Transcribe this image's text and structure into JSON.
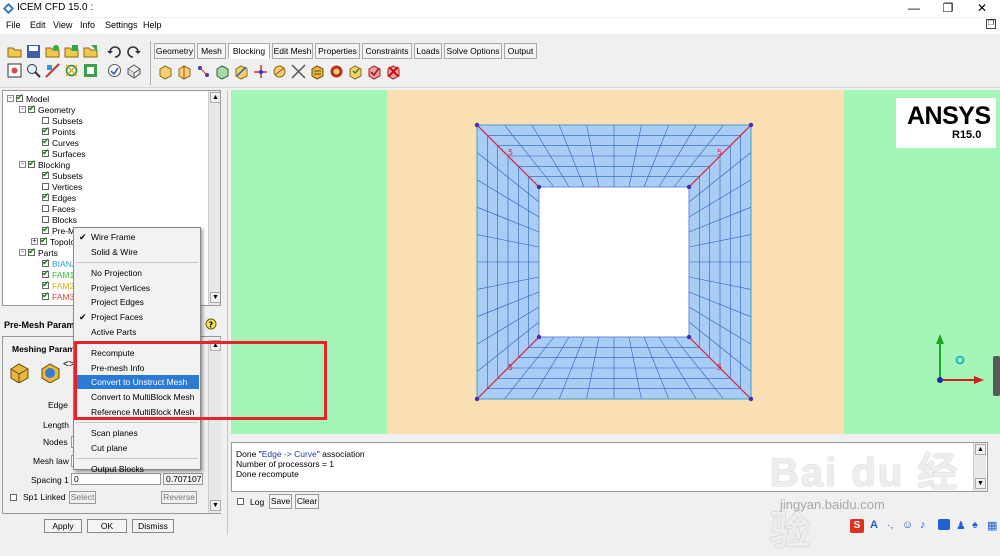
{
  "window": {
    "title": "ICEM CFD 15.0 :",
    "controls": [
      "—",
      "❐",
      "✕"
    ]
  },
  "menubar": [
    "File",
    "Edit",
    "View",
    "Info",
    "Settings",
    "Help"
  ],
  "tabs": [
    {
      "label": "Geometry",
      "active": false
    },
    {
      "label": "Mesh",
      "active": false
    },
    {
      "label": "Blocking",
      "active": true
    },
    {
      "label": "Edit Mesh",
      "active": false
    },
    {
      "label": "Properties",
      "active": false
    },
    {
      "label": "Constraints",
      "active": false
    },
    {
      "label": "Loads",
      "active": false
    },
    {
      "label": "Solve Options",
      "active": false
    },
    {
      "label": "Output",
      "active": false
    }
  ],
  "tree": [
    {
      "label": "Model",
      "level": 0,
      "checked": true,
      "expander": "-",
      "color": "#000000"
    },
    {
      "label": "Geometry",
      "level": 1,
      "checked": true,
      "expander": "-",
      "color": "#000000"
    },
    {
      "label": "Subsets",
      "level": 2,
      "checked": false,
      "color": "#000000"
    },
    {
      "label": "Points",
      "level": 2,
      "checked": true,
      "color": "#000000"
    },
    {
      "label": "Curves",
      "level": 2,
      "checked": true,
      "color": "#000000"
    },
    {
      "label": "Surfaces",
      "level": 2,
      "checked": true,
      "color": "#000000"
    },
    {
      "label": "Blocking",
      "level": 1,
      "checked": true,
      "expander": "-",
      "color": "#000000"
    },
    {
      "label": "Subsets",
      "level": 2,
      "checked": true,
      "color": "#000000"
    },
    {
      "label": "Vertices",
      "level": 2,
      "checked": false,
      "color": "#000000"
    },
    {
      "label": "Edges",
      "level": 2,
      "checked": true,
      "color": "#000000"
    },
    {
      "label": "Faces",
      "level": 2,
      "checked": false,
      "color": "#000000"
    },
    {
      "label": "Blocks",
      "level": 2,
      "checked": false,
      "color": "#000000"
    },
    {
      "label": "Pre-Me",
      "level": 2,
      "checked": true,
      "color": "#000000"
    },
    {
      "label": "Topolo",
      "level": 2,
      "checked": true,
      "expander": "+",
      "color": "#000000"
    },
    {
      "label": "Parts",
      "level": 1,
      "checked": true,
      "expander": "-",
      "color": "#000000"
    },
    {
      "label": "BIANJ",
      "level": 2,
      "checked": true,
      "color": "#2aa0d8"
    },
    {
      "label": "FAM1",
      "level": 2,
      "checked": true,
      "color": "#2ec42e"
    },
    {
      "label": "FAM2",
      "level": 2,
      "checked": true,
      "color": "#d8b000"
    },
    {
      "label": "FAM3",
      "level": 2,
      "checked": true,
      "color": "#e04040"
    }
  ],
  "params": {
    "title": "Pre-Mesh Param",
    "group_title": "Meshing Param",
    "edge_label": "Edge",
    "length_label": "Length",
    "nodes_label": "Nodes",
    "meshlaw_label": "Mesh law",
    "spacing1_label": "Spacing 1",
    "spacing1_value": "0",
    "spacing1_right": "0.707107",
    "sp1linked_label": "Sp1 Linked",
    "select_label": "Select",
    "reverse_label": "Reverse"
  },
  "bottom_buttons": [
    "Apply",
    "OK",
    "Dismiss"
  ],
  "context_menu": [
    {
      "label": "Wire Frame",
      "checked": true
    },
    {
      "label": "Solid & Wire",
      "checked": false
    },
    {
      "separator": true
    },
    {
      "label": "No Projection",
      "checked": false
    },
    {
      "label": "Project Vertices",
      "checked": false
    },
    {
      "label": "Project Edges",
      "checked": false
    },
    {
      "label": "Project Faces",
      "checked": true
    },
    {
      "label": "Active Parts",
      "checked": false
    },
    {
      "separator": true
    },
    {
      "label": "Recompute",
      "checked": false
    },
    {
      "label": "Pre-mesh Info",
      "checked": false
    },
    {
      "label": "Convert to Unstruct Mesh",
      "checked": false,
      "selected": true
    },
    {
      "label": "Convert to MultiBlock Mesh",
      "checked": false
    },
    {
      "label": "Reference MultiBlock Mesh",
      "checked": false
    },
    {
      "separator": true
    },
    {
      "label": "Scan planes",
      "checked": false
    },
    {
      "label": "Cut plane",
      "checked": false
    },
    {
      "separator": true
    },
    {
      "label": "Output Blocks",
      "checked": false
    }
  ],
  "logo": {
    "brand": "ANSYS",
    "release": "R15.0"
  },
  "messages": {
    "line1_prefix": "Done \"",
    "line1_highlight": "Edge -> Curve",
    "line1_suffix": "\" association",
    "line2": "Number of processors = 1",
    "line3": "Done recompute"
  },
  "log_controls": {
    "log_label": "Log",
    "save_label": "Save",
    "clear_label": "Clear"
  },
  "edge_labels": [
    "5",
    "5",
    "5",
    "5"
  ],
  "watermark": {
    "text": "Bai du 经验",
    "url": "jingyan.baidu.com"
  },
  "colors": {
    "viewport_bg": "#a6f5b8",
    "block_bg": "#fadfb4",
    "mesh_fill": "#a9cdf4",
    "mesh_line": "#2a5fc0",
    "edge_red": "#e0203a",
    "highlight_box": "#e8222a",
    "menu_selected": "#2a7ad6"
  }
}
